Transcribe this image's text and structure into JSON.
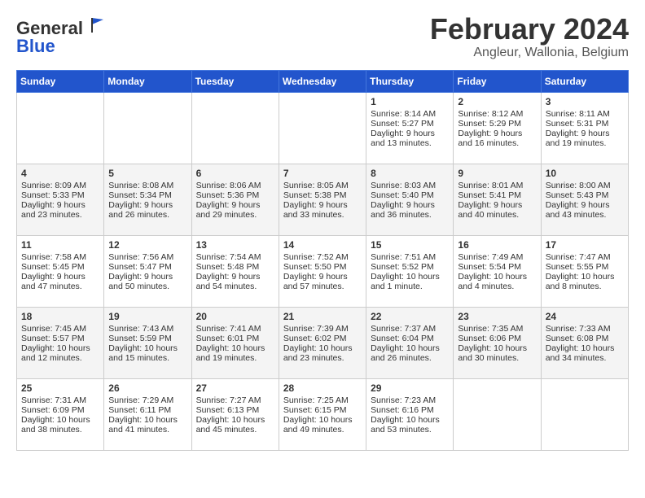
{
  "header": {
    "logo_general": "General",
    "logo_blue": "Blue",
    "month_title": "February 2024",
    "location": "Angleur, Wallonia, Belgium"
  },
  "weekdays": [
    "Sunday",
    "Monday",
    "Tuesday",
    "Wednesday",
    "Thursday",
    "Friday",
    "Saturday"
  ],
  "weeks": [
    [
      {
        "day": "",
        "lines": []
      },
      {
        "day": "",
        "lines": []
      },
      {
        "day": "",
        "lines": []
      },
      {
        "day": "",
        "lines": []
      },
      {
        "day": "1",
        "lines": [
          "Sunrise: 8:14 AM",
          "Sunset: 5:27 PM",
          "Daylight: 9 hours",
          "and 13 minutes."
        ]
      },
      {
        "day": "2",
        "lines": [
          "Sunrise: 8:12 AM",
          "Sunset: 5:29 PM",
          "Daylight: 9 hours",
          "and 16 minutes."
        ]
      },
      {
        "day": "3",
        "lines": [
          "Sunrise: 8:11 AM",
          "Sunset: 5:31 PM",
          "Daylight: 9 hours",
          "and 19 minutes."
        ]
      }
    ],
    [
      {
        "day": "4",
        "lines": [
          "Sunrise: 8:09 AM",
          "Sunset: 5:33 PM",
          "Daylight: 9 hours",
          "and 23 minutes."
        ]
      },
      {
        "day": "5",
        "lines": [
          "Sunrise: 8:08 AM",
          "Sunset: 5:34 PM",
          "Daylight: 9 hours",
          "and 26 minutes."
        ]
      },
      {
        "day": "6",
        "lines": [
          "Sunrise: 8:06 AM",
          "Sunset: 5:36 PM",
          "Daylight: 9 hours",
          "and 29 minutes."
        ]
      },
      {
        "day": "7",
        "lines": [
          "Sunrise: 8:05 AM",
          "Sunset: 5:38 PM",
          "Daylight: 9 hours",
          "and 33 minutes."
        ]
      },
      {
        "day": "8",
        "lines": [
          "Sunrise: 8:03 AM",
          "Sunset: 5:40 PM",
          "Daylight: 9 hours",
          "and 36 minutes."
        ]
      },
      {
        "day": "9",
        "lines": [
          "Sunrise: 8:01 AM",
          "Sunset: 5:41 PM",
          "Daylight: 9 hours",
          "and 40 minutes."
        ]
      },
      {
        "day": "10",
        "lines": [
          "Sunrise: 8:00 AM",
          "Sunset: 5:43 PM",
          "Daylight: 9 hours",
          "and 43 minutes."
        ]
      }
    ],
    [
      {
        "day": "11",
        "lines": [
          "Sunrise: 7:58 AM",
          "Sunset: 5:45 PM",
          "Daylight: 9 hours",
          "and 47 minutes."
        ]
      },
      {
        "day": "12",
        "lines": [
          "Sunrise: 7:56 AM",
          "Sunset: 5:47 PM",
          "Daylight: 9 hours",
          "and 50 minutes."
        ]
      },
      {
        "day": "13",
        "lines": [
          "Sunrise: 7:54 AM",
          "Sunset: 5:48 PM",
          "Daylight: 9 hours",
          "and 54 minutes."
        ]
      },
      {
        "day": "14",
        "lines": [
          "Sunrise: 7:52 AM",
          "Sunset: 5:50 PM",
          "Daylight: 9 hours",
          "and 57 minutes."
        ]
      },
      {
        "day": "15",
        "lines": [
          "Sunrise: 7:51 AM",
          "Sunset: 5:52 PM",
          "Daylight: 10 hours",
          "and 1 minute."
        ]
      },
      {
        "day": "16",
        "lines": [
          "Sunrise: 7:49 AM",
          "Sunset: 5:54 PM",
          "Daylight: 10 hours",
          "and 4 minutes."
        ]
      },
      {
        "day": "17",
        "lines": [
          "Sunrise: 7:47 AM",
          "Sunset: 5:55 PM",
          "Daylight: 10 hours",
          "and 8 minutes."
        ]
      }
    ],
    [
      {
        "day": "18",
        "lines": [
          "Sunrise: 7:45 AM",
          "Sunset: 5:57 PM",
          "Daylight: 10 hours",
          "and 12 minutes."
        ]
      },
      {
        "day": "19",
        "lines": [
          "Sunrise: 7:43 AM",
          "Sunset: 5:59 PM",
          "Daylight: 10 hours",
          "and 15 minutes."
        ]
      },
      {
        "day": "20",
        "lines": [
          "Sunrise: 7:41 AM",
          "Sunset: 6:01 PM",
          "Daylight: 10 hours",
          "and 19 minutes."
        ]
      },
      {
        "day": "21",
        "lines": [
          "Sunrise: 7:39 AM",
          "Sunset: 6:02 PM",
          "Daylight: 10 hours",
          "and 23 minutes."
        ]
      },
      {
        "day": "22",
        "lines": [
          "Sunrise: 7:37 AM",
          "Sunset: 6:04 PM",
          "Daylight: 10 hours",
          "and 26 minutes."
        ]
      },
      {
        "day": "23",
        "lines": [
          "Sunrise: 7:35 AM",
          "Sunset: 6:06 PM",
          "Daylight: 10 hours",
          "and 30 minutes."
        ]
      },
      {
        "day": "24",
        "lines": [
          "Sunrise: 7:33 AM",
          "Sunset: 6:08 PM",
          "Daylight: 10 hours",
          "and 34 minutes."
        ]
      }
    ],
    [
      {
        "day": "25",
        "lines": [
          "Sunrise: 7:31 AM",
          "Sunset: 6:09 PM",
          "Daylight: 10 hours",
          "and 38 minutes."
        ]
      },
      {
        "day": "26",
        "lines": [
          "Sunrise: 7:29 AM",
          "Sunset: 6:11 PM",
          "Daylight: 10 hours",
          "and 41 minutes."
        ]
      },
      {
        "day": "27",
        "lines": [
          "Sunrise: 7:27 AM",
          "Sunset: 6:13 PM",
          "Daylight: 10 hours",
          "and 45 minutes."
        ]
      },
      {
        "day": "28",
        "lines": [
          "Sunrise: 7:25 AM",
          "Sunset: 6:15 PM",
          "Daylight: 10 hours",
          "and 49 minutes."
        ]
      },
      {
        "day": "29",
        "lines": [
          "Sunrise: 7:23 AM",
          "Sunset: 6:16 PM",
          "Daylight: 10 hours",
          "and 53 minutes."
        ]
      },
      {
        "day": "",
        "lines": []
      },
      {
        "day": "",
        "lines": []
      }
    ]
  ]
}
